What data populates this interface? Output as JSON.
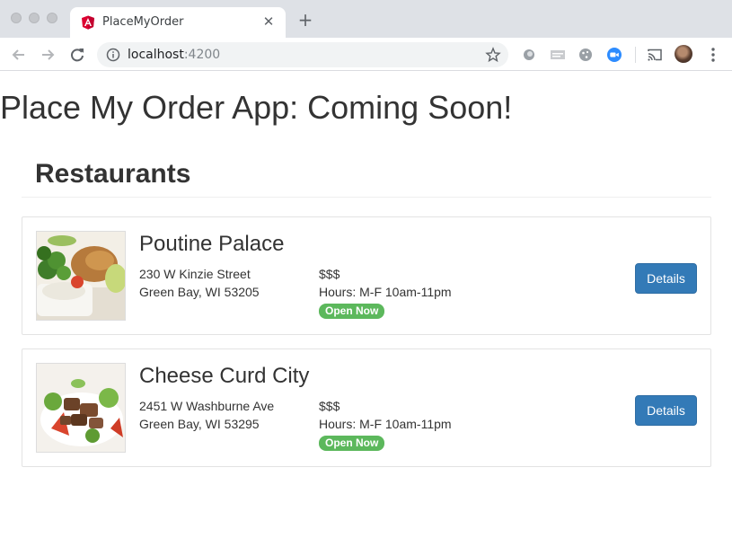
{
  "browser": {
    "tab": {
      "title": "PlaceMyOrder",
      "favicon": "angular-logo-icon"
    },
    "address": {
      "host": "localhost",
      "port": ":4200"
    },
    "colors": {
      "angular_red": "#dd0031",
      "zoom_blue": "#2d8cff"
    }
  },
  "page": {
    "heading": "Place My Order App: Coming Soon!",
    "section_title": "Restaurants"
  },
  "restaurants": [
    {
      "name": "Poutine Palace",
      "street": "230 W Kinzie Street",
      "city_line": "Green Bay, WI 53205",
      "price": "$$$",
      "hours": "Hours: M-F 10am-11pm",
      "status": "Open Now",
      "button": "Details",
      "image": "food-photo-icon"
    },
    {
      "name": "Cheese Curd City",
      "street": "2451 W Washburne Ave",
      "city_line": "Green Bay, WI 53295",
      "price": "$$$",
      "hours": "Hours: M-F 10am-11pm",
      "status": "Open Now",
      "button": "Details",
      "image": "food-photo-icon"
    }
  ],
  "colors": {
    "primary_button": "#337ab7",
    "badge_success": "#5cb85c",
    "text": "#333333"
  }
}
